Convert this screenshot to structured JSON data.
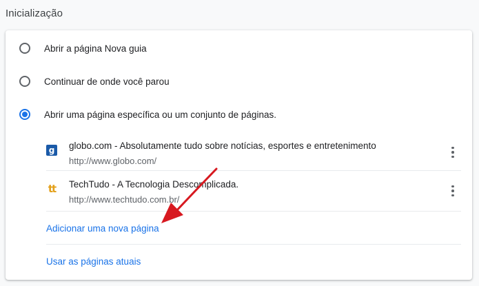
{
  "section": {
    "title": "Inicialização"
  },
  "startup_options": [
    {
      "label": "Abrir a página Nova guia",
      "checked": false
    },
    {
      "label": "Continuar de onde você parou",
      "checked": false
    },
    {
      "label": "Abrir uma página específica ou um conjunto de páginas.",
      "checked": true
    }
  ],
  "pages": [
    {
      "favicon": "g",
      "title": "globo.com - Absolutamente tudo sobre notícias, esportes e entretenimento",
      "url": "http://www.globo.com/"
    },
    {
      "favicon": "tt",
      "title": "TechTudo - A Tecnologia Descomplicada.",
      "url": "http://www.techtudo.com.br/"
    }
  ],
  "actions": {
    "add_page": "Adicionar uma nova página",
    "use_current": "Usar as páginas atuais"
  },
  "colors": {
    "accent": "#1a73e8",
    "annotation_arrow": "#d71920"
  },
  "icons": {
    "more": "more-vert-icon",
    "annotation": "red-arrow-icon"
  }
}
